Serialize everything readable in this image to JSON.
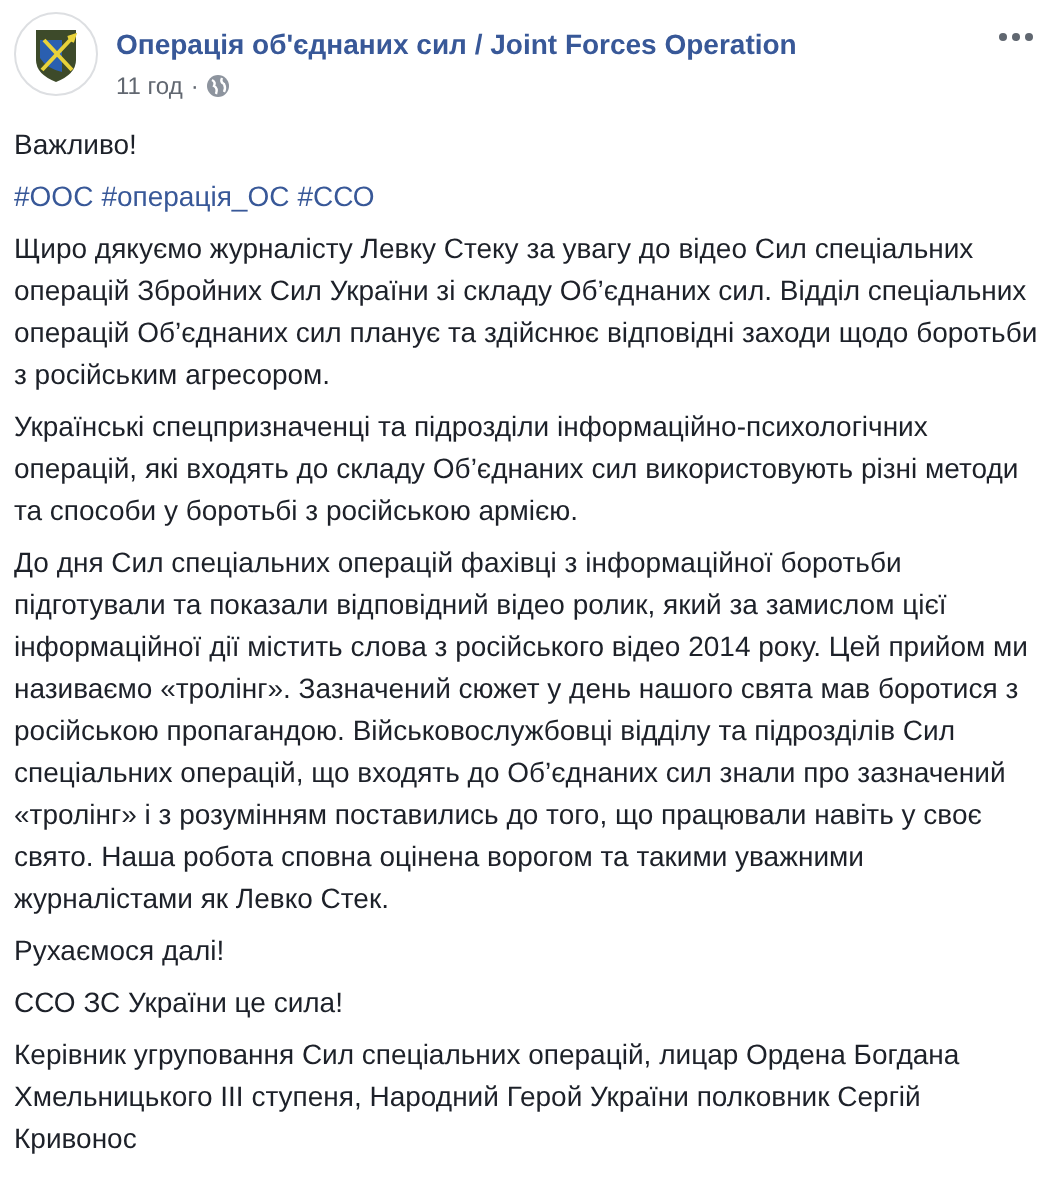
{
  "post": {
    "page_name": "Операція об'єднаних сил / Joint Forces Operation",
    "time": "11 год",
    "separator": "·",
    "paragraphs": [
      {
        "kind": "text",
        "text": "Важливо!"
      },
      {
        "kind": "hashtags",
        "tags": [
          "#ООС",
          "#операція_ОС",
          "#ССО"
        ]
      },
      {
        "kind": "text",
        "text": "Щиро дякуємо журналісту Левку Стеку за увагу до відео Сил спеціальних операцій Збройних Сил України зі складу Об’єднаних сил. Відділ спеціальних операцій Об’єднаних сил планує та здійснює відповідні заходи щодо боротьби з російським агресором."
      },
      {
        "kind": "text",
        "text": "Українські спецпризначенці та підрозділи інформаційно-психологічних операцій, які входять до складу Об’єднаних сил використовують різні методи та способи у боротьбі з російською армією."
      },
      {
        "kind": "text",
        "text": "До дня Сил спеціальних операцій фахівці з інформаційної боротьби підготували та показали відповідний відео ролик, який за замислом цієї інформаційної дії містить слова з російського відео 2014 року. Цей прийом ми називаємо «тролінг». Зазначений сюжет у день нашого свята мав боротися з російською пропагандою. Військовослужбовці відділу та підрозділів Сил спеціальних операцій, що входять до Об’єднаних сил знали про зазначений «тролінг» і з розумінням поставились до того, що працювали навіть у своє свято. Наша робота сповна оцінена ворогом та такими уважними журналістами як Левко Стек."
      },
      {
        "kind": "text",
        "text": "Рухаємося далі!"
      },
      {
        "kind": "text",
        "text": "ССО ЗС України це сила!"
      },
      {
        "kind": "text",
        "text": "Керівник угруповання Сил спеціальних операцій, лицар Ордена Богдана Хмельницького ІІІ ступеня, Народний Герой України полковник Сергій Кривонос"
      }
    ]
  }
}
